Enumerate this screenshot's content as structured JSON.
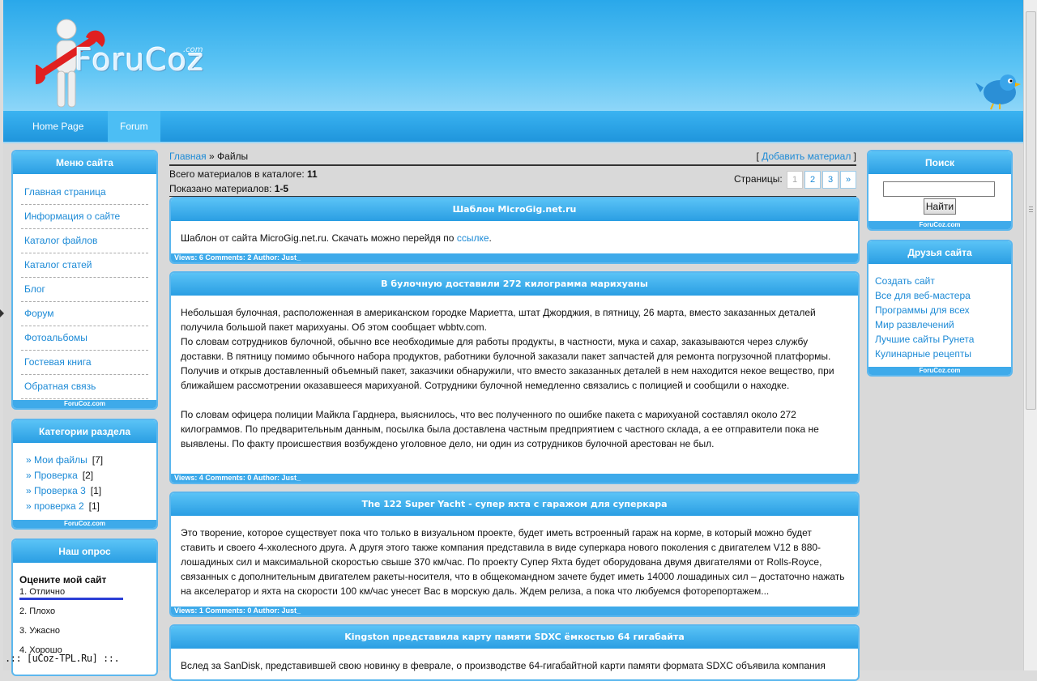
{
  "header": {
    "logo_text": "ForuCoz",
    "logo_suffix": ".com"
  },
  "nav": {
    "items": [
      {
        "label": "Home Page"
      },
      {
        "label": "Forum"
      }
    ]
  },
  "left": {
    "menu": {
      "title": "Меню сайта",
      "items": [
        "Главная страница",
        "Информация о сайте",
        "Каталог файлов",
        "Каталог статей",
        "Блог",
        "Форум",
        "Фотоальбомы",
        "Гостевая книга",
        "Обратная связь"
      ],
      "footer": "ForuCoz.com"
    },
    "categories": {
      "title": "Категории раздела",
      "items": [
        {
          "label": "» Мои файлы",
          "count": "[7]"
        },
        {
          "label": "» Проверка",
          "count": "[2]"
        },
        {
          "label": "» Проверка 3",
          "count": "[1]"
        },
        {
          "label": "» проверка 2",
          "count": "[1]"
        }
      ],
      "footer": "ForuCoz.com"
    },
    "poll": {
      "title": "Наш опрос",
      "question": "Оцените мой сайт",
      "options": [
        "1. Отлично",
        "2. Плохо",
        "3. Ужасно",
        "4. Хорошо"
      ],
      "leading_share": 1.0
    }
  },
  "main": {
    "breadcrumb": {
      "home": "Главная",
      "sep": " » ",
      "current": "Файлы"
    },
    "add_material": {
      "open": "[ ",
      "label": "Добавить материал",
      "close": " ]"
    },
    "catalog_total_label": "Всего материалов в каталоге: ",
    "catalog_total": "11",
    "shown_label": "Показано материалов: ",
    "shown": "1-5",
    "pages_label": "Страницы:",
    "pages": [
      "1",
      "2",
      "3",
      "»"
    ],
    "entries": [
      {
        "title": "Шаблон MicroGig.net.ru",
        "body_pre": "Шаблон от сайта MicroGig.net.ru. Скачать можно перейдя по ",
        "body_link": "ссылке",
        "body_post": ".",
        "footer": "Views: 6 Comments: 2 Author: Just_"
      },
      {
        "title": "В булочную доставили 272 килограмма марихуаны",
        "p1": "Небольшая булочная, расположенная в американском городке Мариетта, штат Джорджия, в пятницу, 26 марта, вместо заказанных деталей получила большой пакет марихуаны. Об этом сообщает wbbtv.com.",
        "p2": "По словам сотрудников булочной, обычно все необходимые для работы продукты, в частности, мука и сахар, заказываются через службу доставки. В пятницу помимо обычного набора продуктов, работники булочной заказали пакет запчастей для ремонта погрузочной платформы. Получив и открыв доставленный объемный пакет, заказчики обнаружили, что вместо заказанных деталей в нем находится некое вещество, при ближайшем рассмотрении оказавшееся марихуаной. Сотрудники булочной немедленно связались с полицией и сообщили о находке.",
        "p3": "По словам офицера полиции Майкла Гарднера, выяснилось, что вес полученного по ошибке пакета с марихуаной составлял около 272 килограммов. По предварительным данным, посылка была доставлена частным предприятием с частного склада, а ее отправители пока не выявлены. По факту происшествия возбуждено уголовное дело, ни один из сотрудников булочной арестован не был.",
        "footer": "Views: 4 Comments: 0 Author: Just_"
      },
      {
        "title": "The 122 Super Yacht - супер яхта с гаражом для суперкара",
        "p1": "Это творение, которое существует пока что только в визуальном проекте, будет иметь встроенный гараж на корме, в который можно будет ставить и своего 4-хколесного друга. А другя этого также компания представила в виде суперкара нового поколения с двигателем V12 в 880-лошадиных сил и максимальной скоростью свыше 370 км/час. По проекту Супер Яхта будет оборудована двумя двигателями от Rolls-Royce, связанных с дополнительным двигателем ракеты-носителя, что в общекомандном зачете будет иметь 14000 лошадиных сил – достаточно нажать на акселератор и яхта на скорости 100 км/час унесет Вас в морскую даль. Ждем релиза, а пока что любуемся фоторепортажем...",
        "footer": "Views: 1 Comments: 0 Author: Just_"
      },
      {
        "title": "Kingston представила карту памяти SDXC ёмкостью 64 гигабайта",
        "p1": "Вслед за SanDisk, представившей свою новинку в феврале, о производстве 64-гигабайтной карти памяти формата SDXC объявила компания"
      }
    ]
  },
  "right": {
    "search": {
      "title": "Поиск",
      "button": "Найти",
      "value": "",
      "footer": "ForuCoz.com"
    },
    "friends": {
      "title": "Друзья сайта",
      "items": [
        "Создать сайт",
        "Все для веб-мастера",
        "Программы для всех",
        "Мир развлечений",
        "Лучшие сайты Рунета",
        "Кулинарные рецепты"
      ],
      "footer": "ForuCoz.com"
    }
  },
  "copyright": ".:: [uCoz-TPL.Ru] ::."
}
